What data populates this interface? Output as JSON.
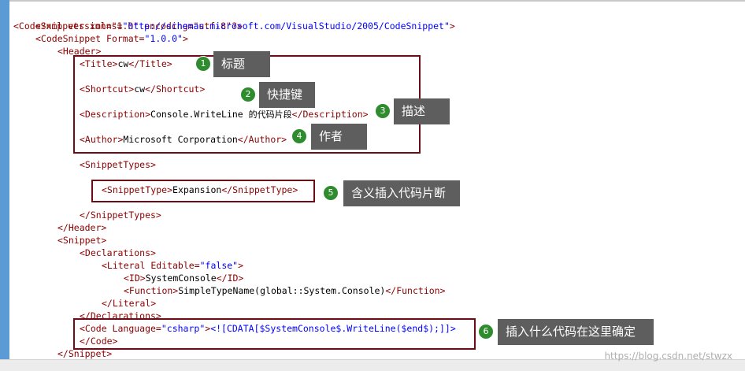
{
  "code_lines": {
    "l1": {
      "a": "<?xml version=\"1.0\" encoding=\"utf-8\"?>"
    },
    "l2": {
      "tag": "<CodeSnippets ",
      "attr": "xmlns=",
      "val": "\"http://schemas.microsoft.com/VisualStudio/2005/CodeSnippet\"",
      "end": ">"
    },
    "l3": {
      "tag": "<CodeSnippet ",
      "attr": "Format=",
      "val": "\"1.0.0\"",
      "end": ">"
    },
    "l4": {
      "tag": "<Header>"
    },
    "l5": {
      "open": "<Title>",
      "text": "cw",
      "close": "</Title>"
    },
    "l6": {
      "open": "<Shortcut>",
      "text": "cw",
      "close": "</Shortcut>"
    },
    "l7": {
      "open": "<Description>",
      "text": "Console.WriteLine ",
      "text_cjk": "的代码片段",
      "close": "</Description>"
    },
    "l8": {
      "open": "<Author>",
      "text": "Microsoft Corporation",
      "close": "</Author>"
    },
    "l9": {
      "tag": "<SnippetTypes>"
    },
    "l10": {
      "open": "<SnippetType>",
      "text": "Expansion",
      "close": "</SnippetType>"
    },
    "l11": {
      "tag": "</SnippetTypes>"
    },
    "l12": {
      "tag": "</Header>"
    },
    "l13": {
      "tag": "<Snippet>"
    },
    "l14": {
      "tag": "<Declarations>"
    },
    "l15": {
      "tag": "<Literal ",
      "attr": "Editable=",
      "val": "\"false\"",
      "end": ">"
    },
    "l16": {
      "open": "<ID>",
      "text": "SystemConsole",
      "close": "</ID>"
    },
    "l17": {
      "open": "<Function>",
      "text": "SimpleTypeName(global::System.Console)",
      "close": "</Function>"
    },
    "l18": {
      "tag": "</Literal>"
    },
    "l19": {
      "tag": "</Declarations>"
    },
    "l20": {
      "tag": "<Code ",
      "attr": "Language=",
      "val": "\"csharp\"",
      "end": ">",
      "cdata": "<![CDATA[$SystemConsole$.WriteLine($end$);]]>"
    },
    "l21": {
      "tag": "</Code>"
    },
    "l22": {
      "tag": "</Snippet>"
    }
  },
  "annotations": [
    {
      "num": "1",
      "label": "标题"
    },
    {
      "num": "2",
      "label": "快捷键"
    },
    {
      "num": "3",
      "label": "描述"
    },
    {
      "num": "4",
      "label": "作者"
    },
    {
      "num": "5",
      "label": "含义插入代码片断"
    },
    {
      "num": "6",
      "label": "插入什么代码在这里确定"
    }
  ],
  "watermark": "https://blog.csdn.net/stwzx",
  "colors": {
    "tag": "#8b0000",
    "attribute_value": "#0000ff",
    "highlight_box": "#6b0c17",
    "badge": "#2e8b2e",
    "callout": "#5e5e5e",
    "gutter": "#5b9bd5"
  }
}
